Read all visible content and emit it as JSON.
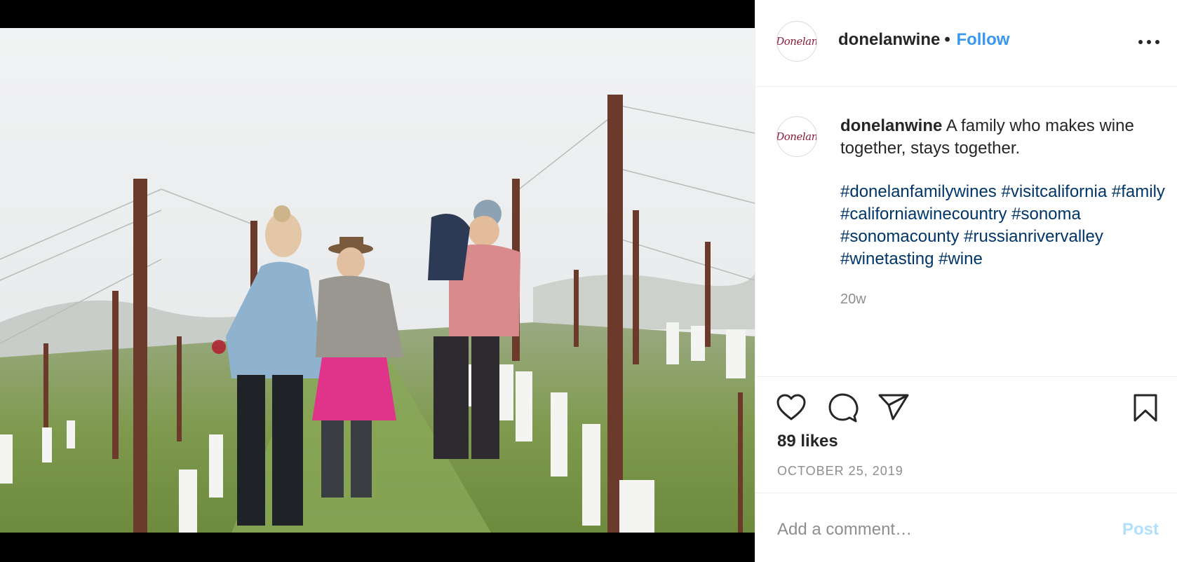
{
  "post": {
    "image": {
      "alt": "Family walking through a vineyard in the rain"
    },
    "header": {
      "username": "donelanwine",
      "separator": "•",
      "follow_label": "Follow",
      "avatar_logo_text": "Donelan"
    },
    "caption": {
      "username": "donelanwine",
      "text": "A family who makes wine together, stays together.",
      "hashtags": [
        "#donelanfamilywines",
        "#visitcalifornia",
        "#family",
        "#californiawinecountry",
        "#sonoma",
        "#sonomacounty",
        "#russianrivervalley",
        "#winetasting",
        "#wine"
      ],
      "age": "20w"
    },
    "actions": {
      "likes": "89 likes",
      "date": "OCTOBER 25, 2019"
    },
    "comment": {
      "placeholder": "Add a comment…",
      "post_label": "Post"
    }
  },
  "icons": {
    "like": "heart-icon",
    "comment": "comment-bubble-icon",
    "share": "paper-plane-icon",
    "save": "bookmark-icon",
    "more": "more-options-icon"
  },
  "colors": {
    "link_blue": "#3897f0",
    "hashtag": "#003569",
    "muted": "#8e8e8e",
    "post_disabled": "#b2dffc",
    "brand_logo": "#8a1f3d"
  }
}
